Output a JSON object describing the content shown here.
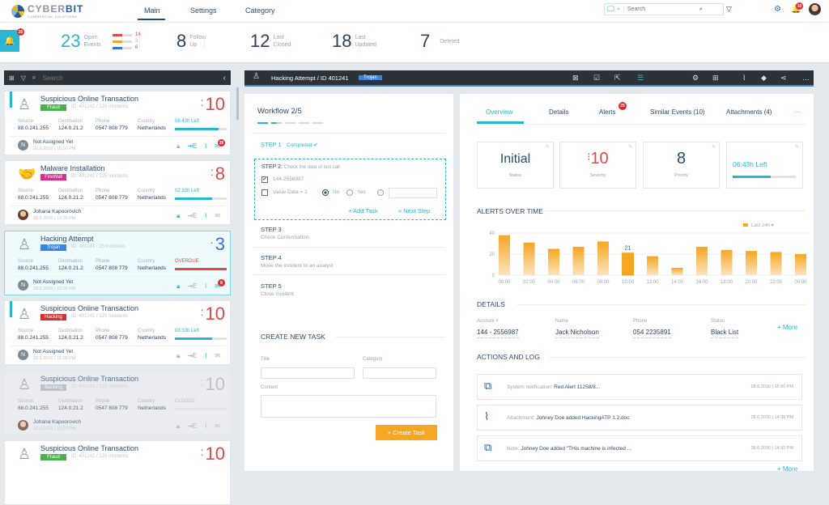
{
  "brand": {
    "name_a": "CYBER",
    "name_b": "BIT",
    "sub": "COMMERCIAL SOLUTIONS"
  },
  "nav": [
    {
      "label": "Main",
      "active": true
    },
    {
      "label": "Settings"
    },
    {
      "label": "Category"
    }
  ],
  "search": {
    "placeholder": "Search"
  },
  "notifications": {
    "count": "10"
  },
  "alert_bell": {
    "count": "20"
  },
  "stats": {
    "open": {
      "value": "23",
      "label1": "Open",
      "label2": "Events",
      "breakdown": [
        "14",
        "3",
        "6"
      ]
    },
    "follow": {
      "value": "8",
      "label1": "Follow",
      "label2": "Up"
    },
    "closed": {
      "value": "12",
      "label1": "Last",
      "label2": "Closed"
    },
    "updated": {
      "value": "18",
      "label1": "Last",
      "label2": "Updated"
    },
    "deleted": {
      "value": "7",
      "label1": "Deleted"
    }
  },
  "list_search": {
    "placeholder": "Search"
  },
  "events": [
    {
      "title": "Suspicious Online Transaction",
      "tag": "Fraud",
      "tag_color": "#4caf50",
      "id": "ID: 401241 / 125 Incidents",
      "severity": "10",
      "sev_dots": ":",
      "time": "06:43h Left",
      "progress": 0.85,
      "assignee": "Not Assigned Yet",
      "date": "28.6.2016 | 15:00 PM",
      "badge": "26",
      "accent": true,
      "avatar": "N"
    },
    {
      "title": "Malware Installation",
      "tag": "FireWall",
      "tag_color": "#d6308f",
      "id": "ID: 401241 / 125 Incidents",
      "severity": "8",
      "sev_dots": ":",
      "time": "02:33h Left",
      "progress": 0.72,
      "assignee": "Johana Kapoorovich",
      "date": "28.6.2016 | 15:00 PM",
      "photo": true
    },
    {
      "title": "Hacking Attempt",
      "tag": "Trojan",
      "tag_color": "#3b82e6",
      "id": "ID: 401241 / 25 Incidents",
      "severity": "3",
      "sev_dots": "·",
      "sev_color": "#3b6fd6",
      "time": "OVERDUE",
      "time_color": "#e04848",
      "progress": 1,
      "bar_color": "#e04848",
      "assignee": "Not Assigned Yet",
      "date": "28.6.2016 | 15:00 PM",
      "badge": "8",
      "selected": true,
      "avatar": "N"
    },
    {
      "title": "Suspicious Online Transaction",
      "tag": "Hacking",
      "tag_color": "#d32f2f",
      "id": "ID: 401241 / 125 Incidents",
      "severity": "10",
      "sev_dots": ":",
      "time": "03:33h Left",
      "progress": 0.72,
      "assignee": "Not Assigned Yet",
      "date": "28.6.2016 | 15:00 PM",
      "accent": true,
      "avatar": "N"
    },
    {
      "title": "Suspicious Online Transaction",
      "tag": "Banking",
      "tag_color": "#b0b6bc",
      "id": "ID: 401241 / 125 Incidents",
      "severity": "10",
      "sev_dots": ":",
      "sev_color": "#b0b6bc",
      "time": "CLOSED",
      "time_color": "#b0b6bc",
      "progress": 0,
      "assignee": "Johana Kapoorovich",
      "date": "28.6.2016 | 15:00 PM",
      "photo": true,
      "dim": true
    },
    {
      "title": "Suspicious Online Transaction",
      "tag": "Fraud",
      "tag_color": "#4caf50",
      "id": "ID: 401241 / 125 Incidents",
      "severity": "10",
      "sev_dots": ":"
    }
  ],
  "event_fields": {
    "source_label": "Source",
    "source": "88.0.241.255",
    "dest_label": "Destination",
    "dest": "124.0.21.2",
    "phone_label": "Phone",
    "phone": "0547 808 779",
    "country_label": "Country",
    "country": "Netherlands"
  },
  "detail": {
    "title": "Hacking Attempt / ID 401241",
    "tag": "Trojan"
  },
  "workflow": {
    "title": "Workflow  2/5",
    "step1": "STEP 1",
    "step1_status": "Completed ✔",
    "step2": "STEP 2:",
    "step2_desc": "Check the data of last call",
    "check1": "144-2556987",
    "check2": "Value Data = 1",
    "radio_no": "No",
    "radio_yes": "Yes",
    "add_task": "+ Add Task",
    "next_step": "» Next Step",
    "steps": [
      {
        "label": "STEP 3",
        "desc": "Check Confermation"
      },
      {
        "label": "STEP 4",
        "desc": "Move the incident to an analyst"
      },
      {
        "label": "STEP 5",
        "desc": "Close incident"
      }
    ]
  },
  "new_task": {
    "title": "CREATE NEW TASK",
    "title_label": "Title",
    "category_label": "Category",
    "content_label": "Content",
    "button": "+  Create Task"
  },
  "tabs": [
    {
      "label": "Overview",
      "active": true
    },
    {
      "label": "Details"
    },
    {
      "label": "Alerts",
      "badge": "25"
    },
    {
      "label": "Similar Events (10)"
    },
    {
      "label": "Attachments (4)"
    },
    {
      "label": "···"
    }
  ],
  "overview": {
    "status": {
      "value": "Initial",
      "label": "Status"
    },
    "severity": {
      "value": "10",
      "label": "Severity"
    },
    "priority": {
      "value": "8",
      "label": "Priority"
    },
    "time": {
      "value": "06:43h Left",
      "progress": 0.6
    }
  },
  "chart_data": {
    "type": "bar",
    "title": "ALERTS OVER TIME",
    "categories": [
      "00:00",
      "02:00",
      "04:00",
      "06:00",
      "08:00",
      "10:00",
      "12:00",
      "14:00",
      "16:00",
      "18:00",
      "20:00",
      "22:00",
      "00:00"
    ],
    "values": [
      38,
      31,
      25,
      27,
      32,
      21,
      18,
      7,
      27,
      24,
      23,
      22,
      20
    ],
    "yticks": [
      0,
      20,
      40
    ],
    "ylim": [
      0,
      40
    ],
    "legend": "Last 24h",
    "highlight_label": "21",
    "color": "#f5a623",
    "grid": true
  },
  "details": {
    "title": "DETAILS",
    "fields": [
      {
        "label": "Account #",
        "value": "144 - 2556987"
      },
      {
        "label": "Name",
        "value": "Jack Nicholson"
      },
      {
        "label": "Phone",
        "value": "054 2235891"
      },
      {
        "label": "Status",
        "value": "Black List"
      }
    ],
    "more": "+ More"
  },
  "log": {
    "title": "ACTIONS AND LOG",
    "items": [
      {
        "icon": "network-icon",
        "kind": "System notification:",
        "text": "Red Alert 11258/8...",
        "date": "28.6.2016 | 15:00 PM"
      },
      {
        "icon": "paperclip-icon",
        "kind": "Attachment:",
        "text": "Johney Doe added HackingATP 1.2.doc",
        "date": "28.6.2016 | 14:38 PM"
      },
      {
        "icon": "network-icon",
        "kind": "Note:",
        "text": "Johney Doe added \"THis machine is infected ...",
        "date": "28.6.2016 | 14:32 PM"
      }
    ],
    "more": "+ More"
  }
}
